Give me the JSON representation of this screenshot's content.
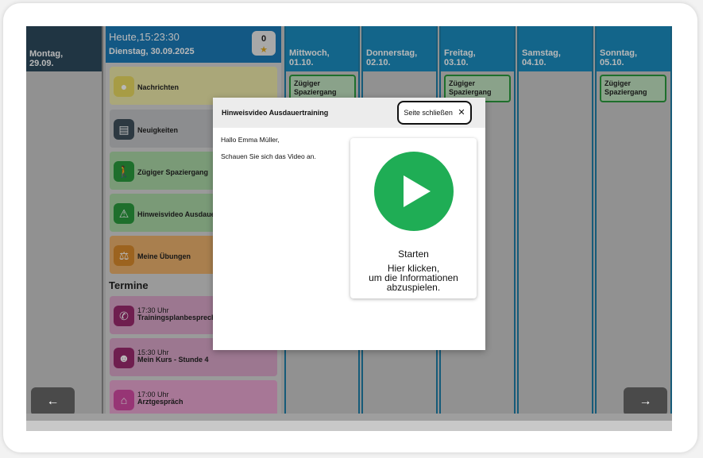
{
  "days": {
    "monday": {
      "name": "Montag,",
      "date": "29.09."
    },
    "wednesday": {
      "name": "Mittwoch,",
      "date": "01.10."
    },
    "thursday": {
      "name": "Donnerstag,",
      "date": "02.10."
    },
    "friday": {
      "name": "Freitag,",
      "date": "03.10."
    },
    "saturday": {
      "name": "Samstag,",
      "date": "04.10."
    },
    "sunday": {
      "name": "Sonntag,",
      "date": "05.10."
    }
  },
  "today": {
    "time": "Heute,15:23:30",
    "date": "Dienstag, 30.09.2025",
    "stars": "0"
  },
  "tiles": {
    "messages": "Nachrichten",
    "news": "Neuigkeiten",
    "walk": "Zügiger Spaziergang",
    "video": "Hinweisvideo Ausdaue",
    "exercises": "Meine Übungen"
  },
  "appointments_title": "Termine",
  "appointments": [
    {
      "time": "17:30 Uhr",
      "title": "Trainingsplanbesprech"
    },
    {
      "time": "15:30 Uhr",
      "title": "Mein Kurs - Stunde 4"
    },
    {
      "time": "17:00 Uhr",
      "title": "Arztgespräch"
    }
  ],
  "walk_card": {
    "line1": "Zügiger",
    "line2": "Spaziergang"
  },
  "modal": {
    "title": "Hinweisvideo Ausdauertraining",
    "close_label": "Seite schließen",
    "greeting": "Hallo Emma Müller,",
    "instruction": "Schauen Sie sich das Video an.",
    "start_label": "Starten",
    "hint_line1": "Hier klicken,",
    "hint_line2": "um die Informationen",
    "hint_line3": "abzuspielen."
  },
  "nav": {
    "prev": "←",
    "next": "→"
  },
  "colors": {
    "header_blue": "#1b8dbf",
    "today_blue": "#1b7ab8",
    "monday_dark": "#2d4a5e",
    "play_green": "#1fad55"
  }
}
